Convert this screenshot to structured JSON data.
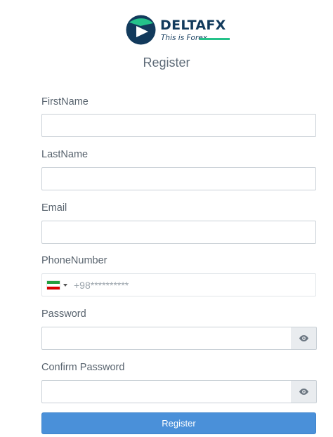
{
  "brand": {
    "name": "DELTAFX",
    "tagline": "This is Forex",
    "colors": {
      "navy": "#123a5c",
      "green": "#25c28a"
    }
  },
  "page_title": "Register",
  "form": {
    "first_name": {
      "label": "FirstName",
      "value": ""
    },
    "last_name": {
      "label": "LastName",
      "value": ""
    },
    "email": {
      "label": "Email",
      "value": ""
    },
    "phone": {
      "label": "PhoneNumber",
      "placeholder": "+98**********",
      "country_flag": "iran-flag-icon",
      "value": ""
    },
    "password": {
      "label": "Password",
      "value": "",
      "toggle_icon": "eye-icon"
    },
    "confirm_password": {
      "label": "Confirm Password",
      "value": "",
      "toggle_icon": "eye-icon"
    },
    "submit_label": "Register"
  },
  "colors": {
    "primary_button": "#4a90d9",
    "label_text": "#58636e",
    "input_border": "#c9d0d6"
  }
}
